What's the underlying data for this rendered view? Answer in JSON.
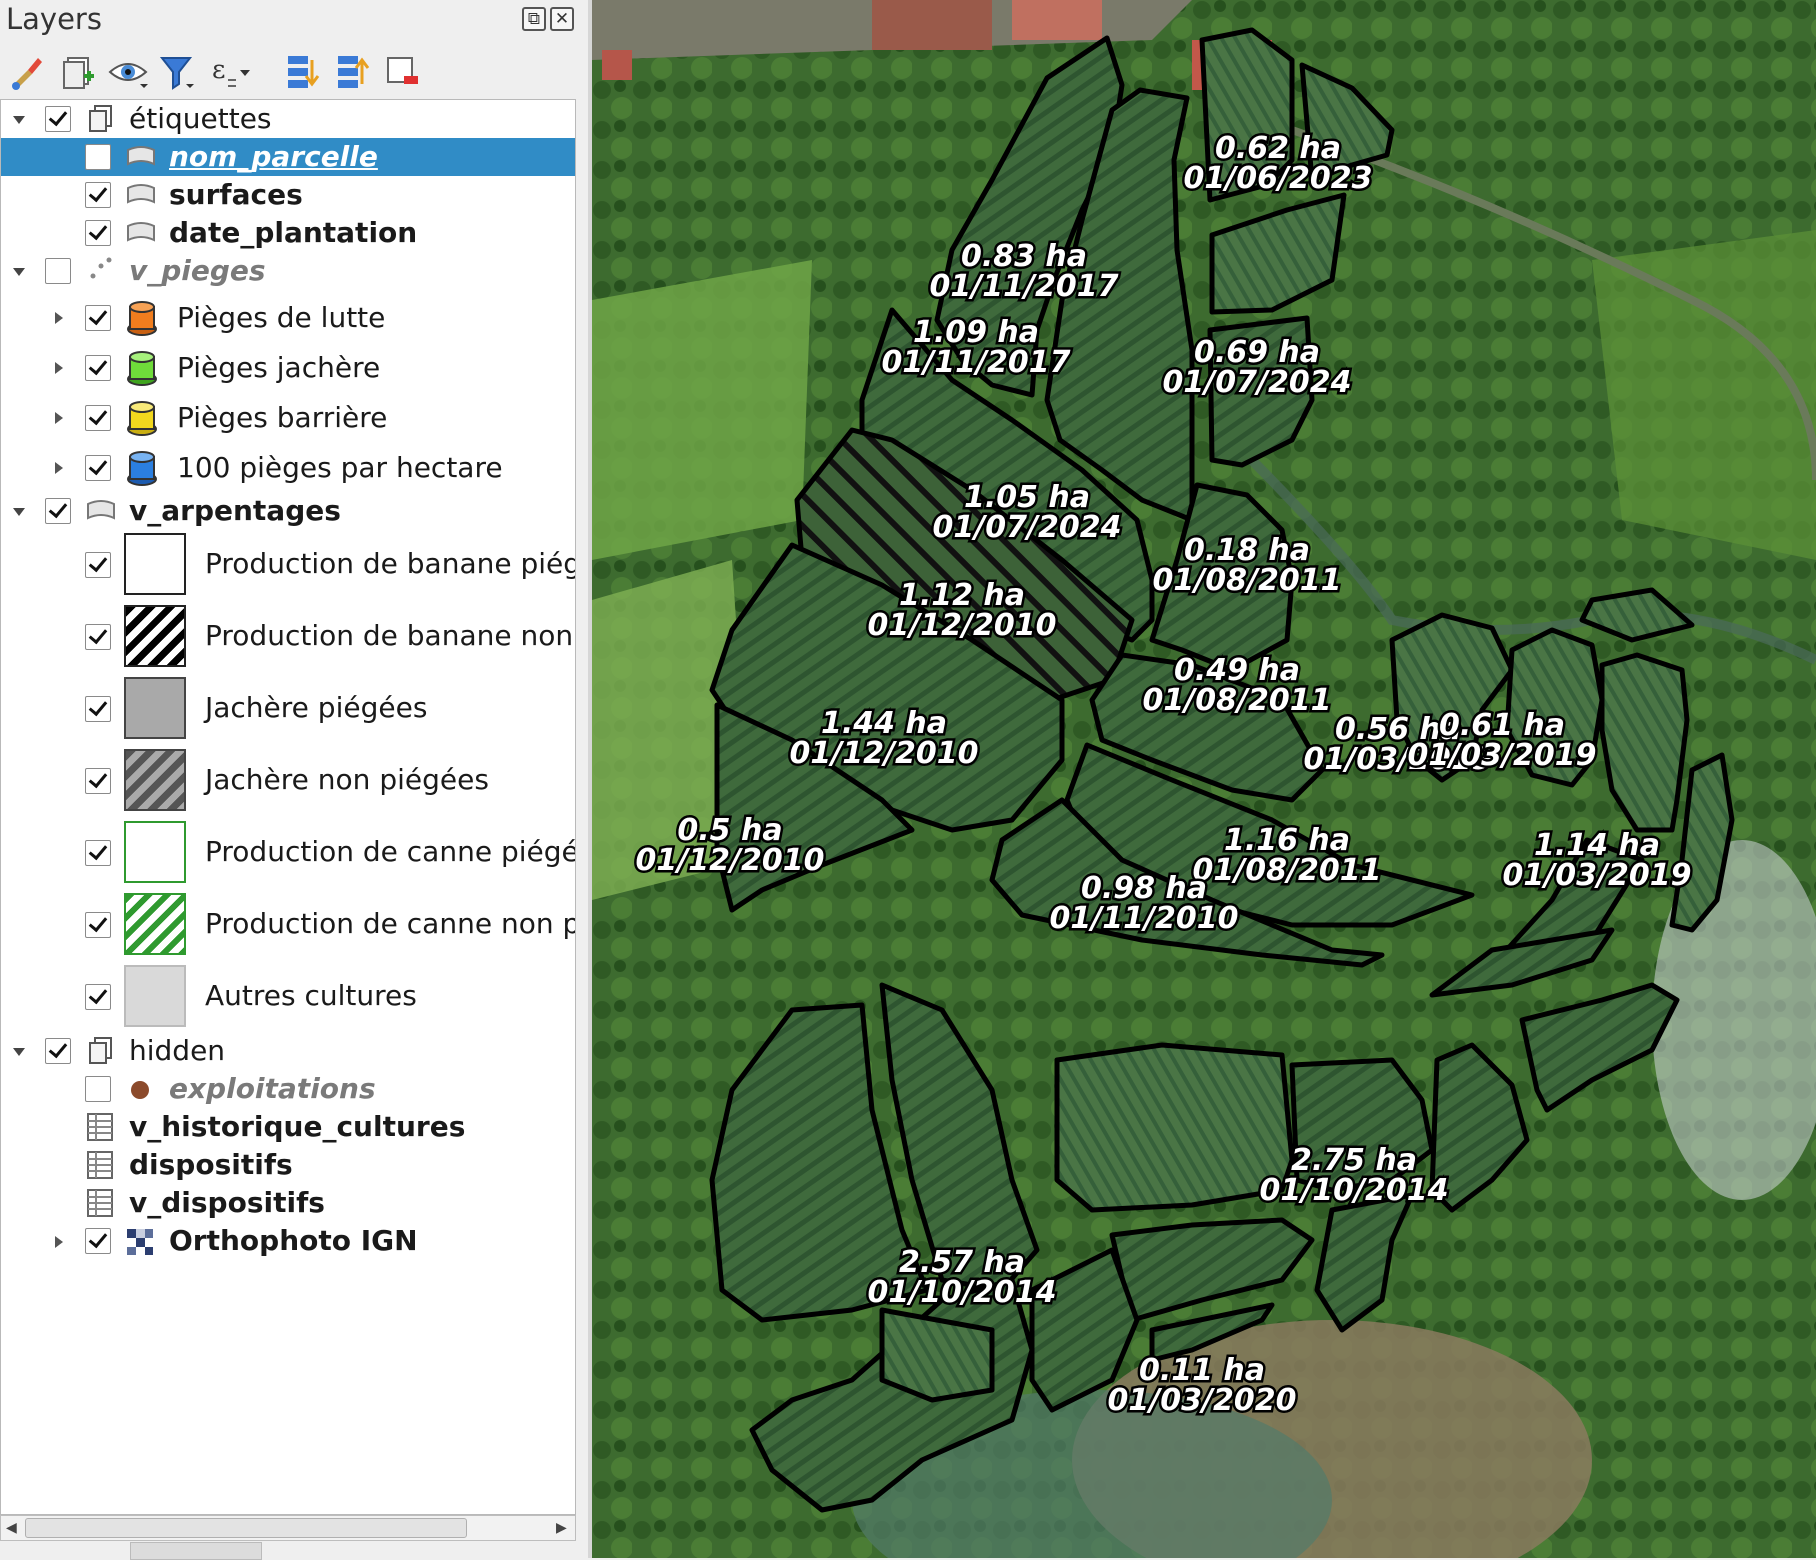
{
  "panel": {
    "title": "Layers"
  },
  "toolbar": [
    {
      "name": "style-manager-icon"
    },
    {
      "name": "add-group-icon"
    },
    {
      "name": "visibility-eye-icon"
    },
    {
      "name": "filter-legend-icon"
    },
    {
      "name": "expression-filter-icon"
    },
    {
      "name": "expand-all-icon"
    },
    {
      "name": "collapse-all-icon"
    },
    {
      "name": "remove-layer-icon"
    }
  ],
  "tree": {
    "etiquettes": {
      "label": "étiquettes",
      "checked": true
    },
    "nom_parcelle": {
      "label": "nom_parcelle",
      "checked": false
    },
    "surfaces": {
      "label": "surfaces",
      "checked": true
    },
    "date_plantation": {
      "label": "date_plantation",
      "checked": true
    },
    "v_pieges": {
      "label": "v_pieges",
      "checked": false
    },
    "pieges": [
      {
        "label": "Pièges de lutte",
        "color": "#f07d1e",
        "checked": true
      },
      {
        "label": "Pièges jachère",
        "color": "#6fdc3a",
        "checked": true
      },
      {
        "label": "Pièges barrière",
        "color": "#f2d81e",
        "checked": true
      },
      {
        "label": "100 pièges par hectare",
        "color": "#2b7fe0",
        "checked": true
      }
    ],
    "v_arpentages": {
      "label": "v_arpentages",
      "checked": true
    },
    "arpentage_classes": [
      {
        "label": "Production de banane piégées",
        "style": "white"
      },
      {
        "label": "Production de banane non piégées",
        "style": "black-hatch"
      },
      {
        "label": "Jachère piégées",
        "style": "grey"
      },
      {
        "label": "Jachère non piégées",
        "style": "grey-hatch"
      },
      {
        "label": "Production de canne piégées",
        "style": "green-outline"
      },
      {
        "label": "Production de canne non piégées",
        "style": "green-hatch"
      },
      {
        "label": "Autres cultures",
        "style": "light-grey"
      }
    ],
    "hidden": {
      "label": "hidden",
      "checked": true
    },
    "exploitations": {
      "label": "exploitations",
      "checked": false,
      "color": "#8b4a2b"
    },
    "v_historique_cultures": {
      "label": "v_historique_cultures"
    },
    "dispositifs": {
      "label": "dispositifs"
    },
    "v_dispositifs": {
      "label": "v_dispositifs"
    },
    "orthophoto": {
      "label": "Orthophoto IGN",
      "checked": true
    }
  },
  "map": {
    "parcel_labels": [
      {
        "area": "0.62 ha",
        "date": "01/06/2023"
      },
      {
        "area": "0.83 ha",
        "date": "01/11/2017"
      },
      {
        "area": "1.09 ha",
        "date": "01/11/2017"
      },
      {
        "area": "0.69 ha",
        "date": "01/07/2024"
      },
      {
        "area": "1.05 ha",
        "date": "01/07/2024"
      },
      {
        "area": "0.18 ha",
        "date": "01/08/2011"
      },
      {
        "area": "1.12 ha",
        "date": "01/12/2010"
      },
      {
        "area": "0.49 ha",
        "date": "01/08/2011"
      },
      {
        "area": "1.44 ha",
        "date": "01/12/2010"
      },
      {
        "area": "0.56 ha",
        "date": "01/03/2019"
      },
      {
        "area": "0.61 ha",
        "date": "01/03/2019"
      },
      {
        "area": "0.5 ha",
        "date": "01/12/2010"
      },
      {
        "area": "1.16 ha",
        "date": "01/08/2011"
      },
      {
        "area": "1.14 ha",
        "date": "01/03/2019"
      },
      {
        "area": "0.98 ha",
        "date": "01/11/2010"
      },
      {
        "area": "2.75 ha",
        "date": "01/10/2014"
      },
      {
        "area": "2.57 ha",
        "date": "01/10/2014"
      },
      {
        "area": "0.11 ha",
        "date": "01/03/2020"
      }
    ]
  }
}
